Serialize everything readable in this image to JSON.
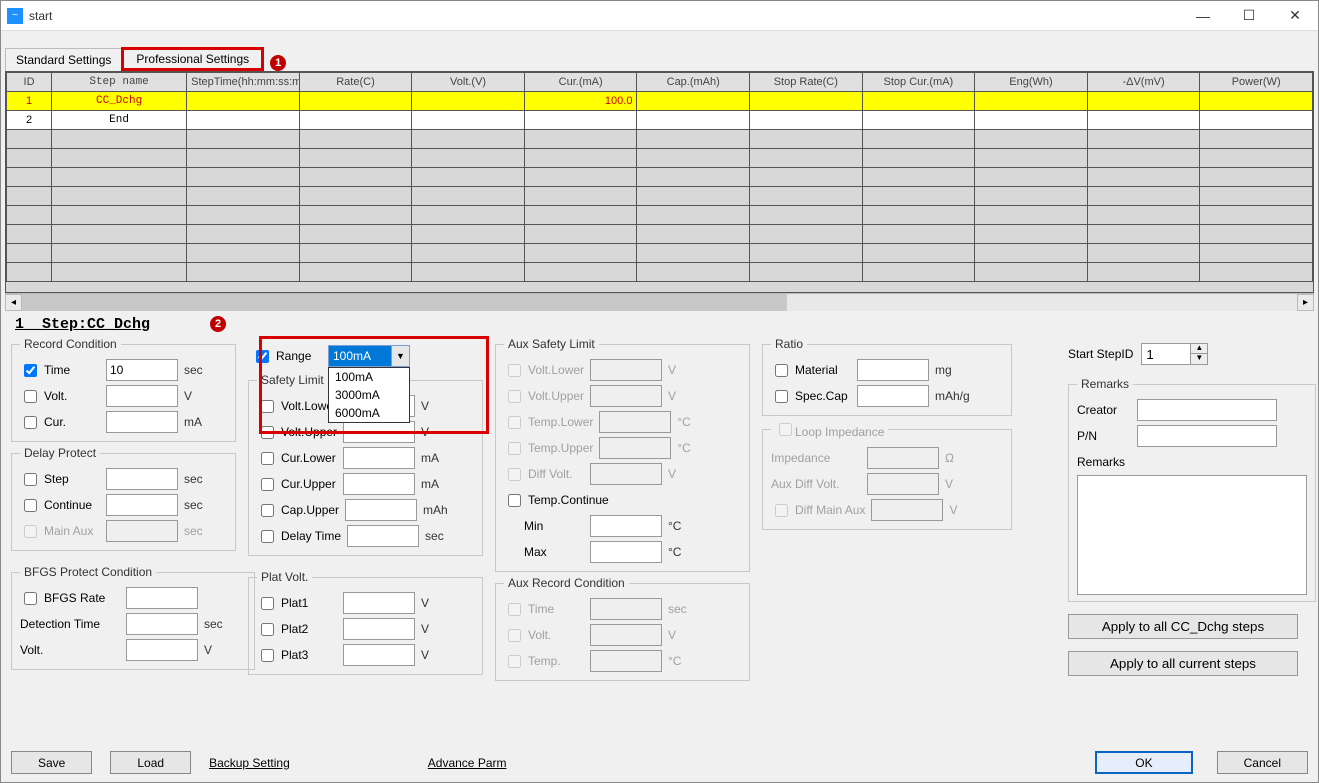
{
  "window": {
    "title": "start"
  },
  "tabs": {
    "standard": "Standard Settings",
    "professional": "Professional Settings"
  },
  "callouts": {
    "one": "1",
    "two": "2"
  },
  "grid": {
    "headers": [
      "ID",
      "Step name",
      "StepTime(hh:mm:ss:ms)",
      "Rate(C)",
      "Volt.(V)",
      "Cur.(mA)",
      "Cap.(mAh)",
      "Stop Rate(C)",
      "Stop Cur.(mA)",
      "Eng(Wh)",
      "-ΔV(mV)",
      "Power(W)"
    ],
    "rows": [
      {
        "id": "1",
        "name": "CC_Dchg",
        "cur": "100.0",
        "hl": true
      },
      {
        "id": "2",
        "name": "End",
        "hl": false
      }
    ]
  },
  "step_title": "1__Step:CC_Dchg",
  "range": {
    "label": "Range",
    "selected": "100mA",
    "options": [
      "100mA",
      "3000mA",
      "6000mA"
    ]
  },
  "safety": {
    "legend": "Safety Limit",
    "volt_lower": "Volt.Lower",
    "volt_upper": "Volt.Upper",
    "cur_lower": "Cur.Lower",
    "cur_upper": "Cur.Upper",
    "cap_upper": "Cap.Upper",
    "delay_time": "Delay Time"
  },
  "record": {
    "legend": "Record Condition",
    "time_label": "Time",
    "time_value": "10",
    "time_unit": "sec",
    "volt_label": "Volt.",
    "cur_label": "Cur."
  },
  "delay_protect": {
    "legend": "Delay Protect",
    "step": "Step",
    "continue": "Continue",
    "main_aux": "Main Aux"
  },
  "bfgs": {
    "legend": "BFGS Protect Condition",
    "rate": "BFGS Rate",
    "detection": "Detection Time",
    "volt": "Volt."
  },
  "plat": {
    "legend": "Plat Volt.",
    "p1": "Plat1",
    "p2": "Plat2",
    "p3": "Plat3"
  },
  "aux_safety": {
    "legend": "Aux Safety Limit",
    "vl": "Volt.Lower",
    "vu": "Volt.Upper",
    "tl": "Temp.Lower",
    "tu": "Temp.Upper",
    "dv": "Diff Volt.",
    "tc": "Temp.Continue",
    "min": "Min",
    "max": "Max"
  },
  "aux_record": {
    "legend": "Aux Record Condition",
    "time": "Time",
    "volt": "Volt.",
    "temp": "Temp."
  },
  "ratio": {
    "legend": "Ratio",
    "material": "Material",
    "spec": "Spec.Cap"
  },
  "loop": {
    "legend": "Loop Impedance",
    "imp": "Impedance",
    "adv": "Aux Diff Volt.",
    "dma": "Diff Main Aux"
  },
  "right": {
    "start_step": "Start StepID",
    "start_val": "1",
    "remarks_legend": "Remarks",
    "creator": "Creator",
    "pn": "P/N",
    "remarks": "Remarks",
    "apply_dchg": "Apply to all CC_Dchg steps",
    "apply_current": "Apply to all current steps"
  },
  "footer": {
    "save": "Save",
    "load": "Load",
    "backup": "Backup Setting",
    "adv": "Advance Parm",
    "ok": "OK",
    "cancel": "Cancel"
  },
  "units": {
    "v": "V",
    "ma": "mA",
    "mah": "mAh",
    "sec": "sec",
    "c": "°C",
    "mg": "mg",
    "mahg": "mAh/g",
    "ohm": "Ω"
  }
}
